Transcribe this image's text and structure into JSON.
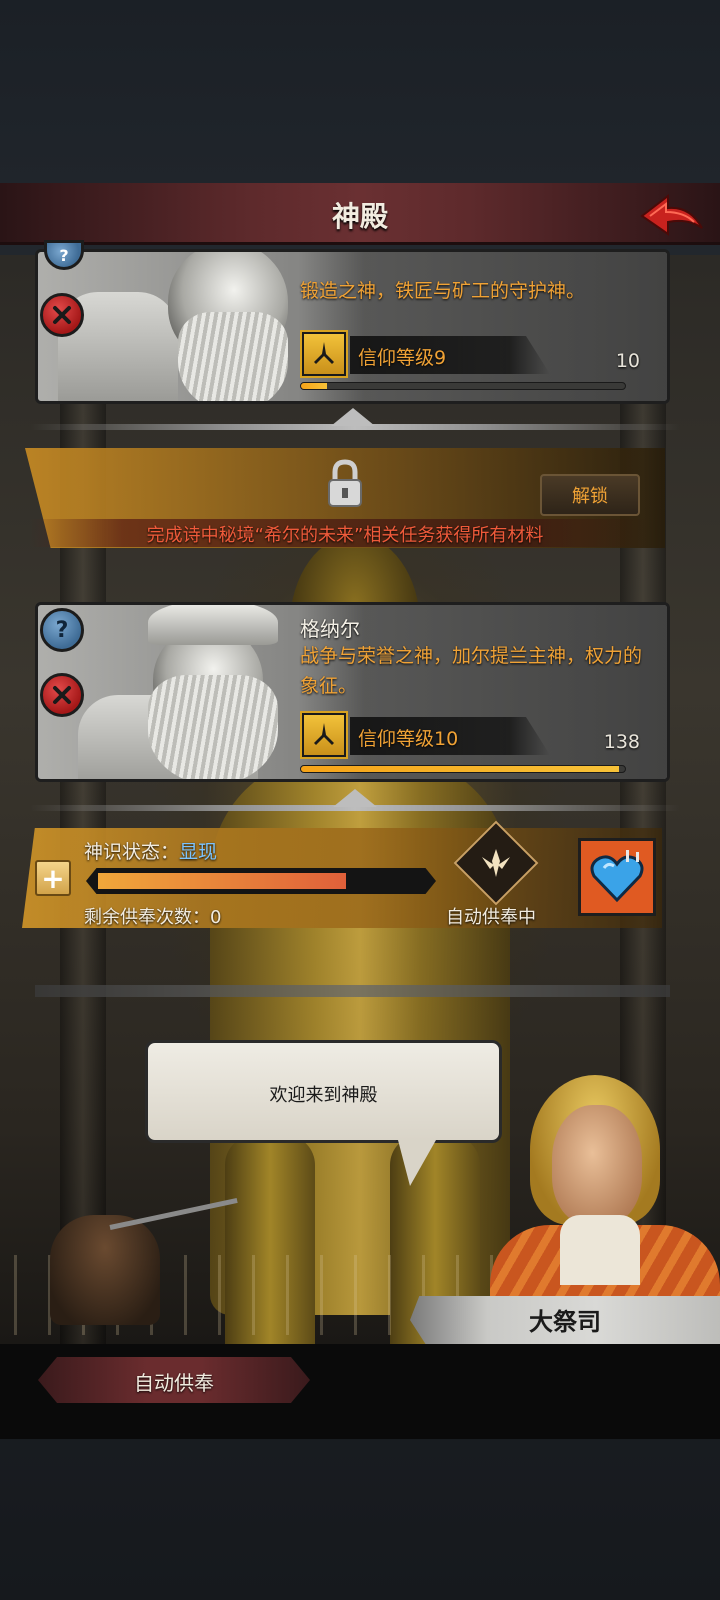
{
  "header": {
    "title": "神殿"
  },
  "gods": [
    {
      "name": "",
      "desc": "锻造之神，铁匠与矿工的守护神。",
      "faith_label": "信仰等级9",
      "faith_count": "10",
      "faith_progress": 0.08
    },
    {
      "name": "格纳尔",
      "desc": "战争与荣誉之神，加尔提兰主神，权力的象征。",
      "faith_label": "信仰等级10",
      "faith_count": "138",
      "faith_progress": 0.98
    }
  ],
  "locked_god": {
    "unlock_label": "解锁",
    "requirement": "完成诗中秘境“希尔的未来”相关任务获得所有材料"
  },
  "spirit": {
    "status_label": "神识状态：",
    "status_value": "显现",
    "progress": 0.76,
    "remaining_label": "剩余供奉次数：0",
    "auto_status": "自动供奉中"
  },
  "dialog": {
    "text": "欢迎来到神殿",
    "speaker": "大祭司"
  },
  "bottom": {
    "auto_offer_label": "自动供奉"
  },
  "colors": {
    "accent_orange": "#f0a235",
    "header_red": "#6a3032",
    "alert_red": "#ef5a3a",
    "status_blue": "#7cc4ff"
  },
  "icons": {
    "back": "back-arrow-icon",
    "remove": "close-x-icon",
    "info": "question-icon",
    "faith": "prayer-hands-icon",
    "lock": "padlock-icon",
    "auto_offer": "sun-emblem-icon",
    "heart": "heart-pendant-icon",
    "plus": "plus-icon"
  }
}
